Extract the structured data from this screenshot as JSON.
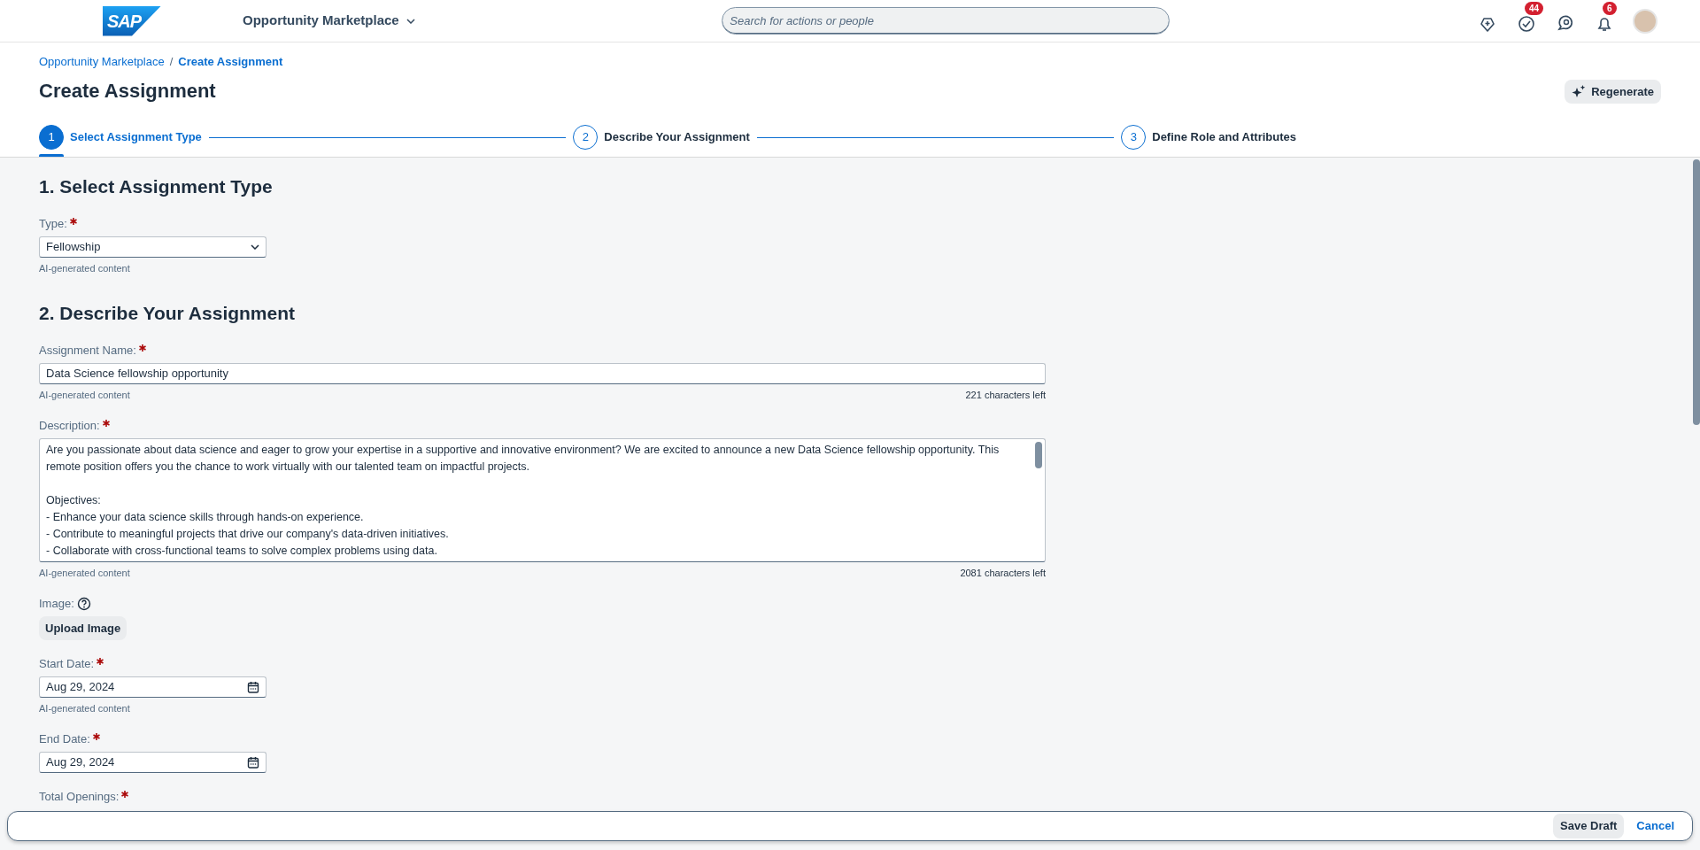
{
  "shell": {
    "logo": "SAP",
    "app_title": "Opportunity Marketplace",
    "search": {
      "placeholder": "Search for actions or people"
    },
    "actions": [
      {
        "kind": "pin"
      },
      {
        "kind": "tasks",
        "badge": "44"
      },
      {
        "kind": "chat"
      },
      {
        "kind": "bell",
        "badge": "6"
      },
      {
        "kind": "avatar"
      }
    ]
  },
  "breadcrumb_separator": "/",
  "breadcrumbs": [
    {
      "label": "Opportunity Marketplace",
      "current": false
    },
    {
      "label": "Create Assignment",
      "current": true
    }
  ],
  "title": "Create Assignment",
  "regenerate_button": "Regenerate",
  "steps": [
    {
      "number": "1",
      "label": "Select Assignment Type",
      "selected": true
    },
    {
      "number": "2",
      "label": "Describe Your Assignment",
      "selected": false
    },
    {
      "number": "3",
      "label": "Define Role and Attributes",
      "selected": false
    }
  ],
  "sections": [
    {
      "heading": "1. Select Assignment Type",
      "fields": [
        {
          "kind": "select",
          "label": "Type:",
          "required": true,
          "value": "Fellowship",
          "helper": "AI-generated content"
        }
      ]
    },
    {
      "heading": "2. Describe Your Assignment",
      "fields": [
        {
          "kind": "input",
          "label": "Assignment Name:",
          "required": true,
          "value": "Data Science fellowship opportunity",
          "helper": "AI-generated content",
          "counter": "221 characters left"
        },
        {
          "kind": "textarea",
          "label": "Description:",
          "required": true,
          "value": "Are you passionate about data science and eager to grow your expertise in a supportive and innovative environment? We are excited to announce a new Data Science fellowship opportunity. This remote position offers you the chance to work virtually with our talented team on impactful projects.\n\nObjectives:\n- Enhance your data science skills through hands-on experience.\n- Contribute to meaningful projects that drive our company's data-driven initiatives.\n- Collaborate with cross-functional teams to solve complex problems using data.",
          "helper": "AI-generated content",
          "counter": "2081 characters left"
        },
        {
          "kind": "upload",
          "label": "Image:",
          "required": false,
          "button": "Upload Image"
        },
        {
          "kind": "date",
          "label": "Start Date:",
          "required": true,
          "value": "Aug 29, 2024",
          "helper": "AI-generated content"
        },
        {
          "kind": "date",
          "label": "End Date:",
          "required": true,
          "value": "Aug 29, 2024"
        },
        {
          "kind": "label",
          "label": "Total Openings:",
          "required": true
        }
      ]
    }
  ],
  "footer": {
    "buttons": [
      {
        "label": "Save Draft",
        "kind": "default"
      },
      {
        "label": "Cancel",
        "kind": "link"
      }
    ]
  }
}
